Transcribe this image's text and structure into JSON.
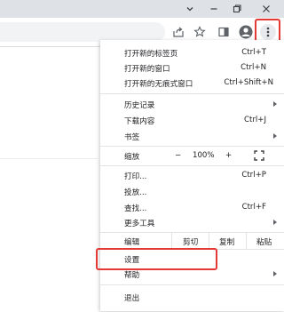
{
  "window_controls": {
    "chevron": "chevron-down",
    "minimize": "–",
    "maximize": "restore",
    "close": "×"
  },
  "toolbar": {
    "icons": [
      "share-icon",
      "star-icon",
      "side-panel-icon",
      "profile-icon",
      "more-vert-icon"
    ]
  },
  "menu": {
    "new_tab": {
      "label": "打开新的标签页",
      "shortcut": "Ctrl+T"
    },
    "new_window": {
      "label": "打开新的窗口",
      "shortcut": "Ctrl+N"
    },
    "new_incognito": {
      "label": "打开新的无痕式窗口",
      "shortcut": "Ctrl+Shift+N"
    },
    "history": {
      "label": "历史记录"
    },
    "downloads": {
      "label": "下载内容",
      "shortcut": "Ctrl+J"
    },
    "bookmarks": {
      "label": "书签"
    },
    "zoom": {
      "label": "缩放",
      "minus": "−",
      "value": "100%",
      "plus": "+"
    },
    "print": {
      "label": "打印...",
      "shortcut": "Ctrl+P"
    },
    "cast": {
      "label": "投放..."
    },
    "find": {
      "label": "查找...",
      "shortcut": "Ctrl+F"
    },
    "more_tools": {
      "label": "更多工具"
    },
    "edit": {
      "label": "编辑",
      "cut": "剪切",
      "copy": "复制",
      "paste": "粘贴"
    },
    "settings": {
      "label": "设置"
    },
    "help": {
      "label": "帮助"
    },
    "exit": {
      "label": "退出"
    }
  },
  "highlight_color": "#e53935"
}
